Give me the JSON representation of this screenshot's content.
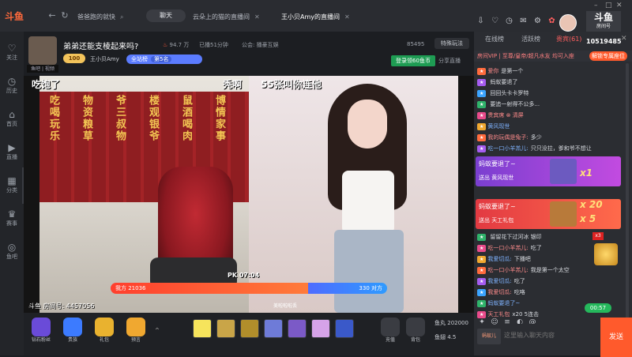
{
  "app": {
    "logo_text": "斗鱼",
    "brand": {
      "title": "斗鱼",
      "sub": "房间号"
    }
  },
  "tabs": [
    {
      "label": "爸爸跑的就快"
    },
    {
      "label": "云朵上的猫的直播间"
    },
    {
      "label": "王小贝Amy的直播间"
    }
  ],
  "chat_pill": "聊天",
  "leftnav": [
    {
      "icon": "heart-icon",
      "glyph": "♡",
      "label": "关注"
    },
    {
      "icon": "history-icon",
      "glyph": "◷",
      "label": "历史"
    },
    {
      "icon": "home-icon",
      "glyph": "⌂",
      "label": "首页"
    },
    {
      "icon": "live-icon",
      "glyph": "▶",
      "label": "直播"
    },
    {
      "icon": "category-icon",
      "glyph": "▦",
      "label": "分类"
    },
    {
      "icon": "trophy-icon",
      "glyph": "♛",
      "label": "赛事"
    },
    {
      "icon": "fishbar-icon",
      "glyph": "◎",
      "label": "鱼吧"
    }
  ],
  "room": {
    "title": "弟弟还能支棱起来吗?",
    "hot": "94.7 万",
    "followers": "已播51分钟",
    "notice": "公会: 播豪互娱",
    "room_id": "85495",
    "report": "特殊玩法",
    "level": "100",
    "host_name": "王小贝Amy",
    "rank_label": "全站榜",
    "rank_value": "第5名",
    "login_btn": "登录领60鱼币",
    "notice2": "分享直播",
    "host_tag": "鱼吧 | 视频"
  },
  "stream": {
    "overlay_left": "吃饱了",
    "overlay_mid": "秃啊",
    "overlay_right": "55张叫你连他",
    "pk_timer": "PK 07:04",
    "pk_left": "我方 21036",
    "pk_right": "330 对方",
    "watermark": "斗鱼 房间号: 4457056",
    "right_name": "美啦啦啦丢"
  },
  "banner_words": [
    "吃喝玩乐",
    "物资粮草",
    "爷三叔物",
    "楼观银爷",
    "鼠酒喝肉",
    "博情家事"
  ],
  "giftbar": {
    "buttons": [
      {
        "name": "diamond-fans-button",
        "label": "钻石粉丝",
        "color": "#6a4bd8"
      },
      {
        "name": "noble-button",
        "label": "贵族",
        "color": "#3c7bff"
      },
      {
        "name": "gift-pack-button",
        "label": "礼包",
        "color": "#e9b22f"
      },
      {
        "name": "guess-button",
        "label": "预言",
        "color": "#f0a830"
      }
    ],
    "gifts": [
      "#f6e45c",
      "#c9a548",
      "#b18e2b",
      "#6e7bd8",
      "#7b5ac7",
      "#d6a3e8",
      "#3a59c9"
    ],
    "recharge": "充值",
    "backpack": "背包",
    "fish_balls_label": "鱼丸",
    "fish_balls": "202000",
    "fish_coins_label": "鱼翅",
    "fish_coins": "4.5"
  },
  "sidepanel": {
    "room_no": "10519485",
    "tabs": [
      "在线榜",
      "活跃榜",
      "贵宾(61)"
    ],
    "notice": "房间VIP | 至尊/皇帝/超凡水友 均可入座",
    "unlock": "解锁专属座位",
    "messages": [
      {
        "user": "爱你",
        "text": "是第一个"
      },
      {
        "user": "",
        "text": "蚂蚁要退了"
      },
      {
        "user": "",
        "text": "回回头卡卡罗特"
      },
      {
        "user": "",
        "text": "要追一射得不公多..."
      },
      {
        "user": "贵宾席 ⊗ 清屏",
        "text": ""
      },
      {
        "user": "黄风现世",
        "text": ""
      },
      {
        "user": "我的玩偶是兔子:",
        "text": "多少"
      },
      {
        "user": "吃一口小羊羔儿:",
        "text": "只只没拉，爹和爷不想让"
      }
    ],
    "banner1": {
      "title": "蚂蚁要退了~",
      "sub": "送出 黄风现世",
      "count": "x1"
    },
    "banner2": {
      "title": "蚂蚁要退了~",
      "sub": "送出 天工礼包",
      "count_a": "x 20",
      "count_b": "x 5"
    },
    "messages2": [
      {
        "user": "",
        "text": "留留花下过河冰 银印"
      },
      {
        "user": "吃一口小羊羔儿:",
        "text": "吃了"
      },
      {
        "user": "我爱切瓜:",
        "text": "下播吧"
      },
      {
        "user": "吃一口小羊羔儿:",
        "text": "我是第一个太空"
      },
      {
        "user": "我爱切瓜:",
        "text": "吃了"
      },
      {
        "user": "我爱切瓜:",
        "text": "吃咯"
      },
      {
        "user": "蚂蚁要退了~",
        "text": ""
      },
      {
        "user": "天工礼包",
        "text": "x20 5连击"
      }
    ],
    "x3": "x3",
    "green_btn": "00:57",
    "user_chip": "蚂蚁儿",
    "input_placeholder": "这里输入聊天内容",
    "send": "发送"
  }
}
